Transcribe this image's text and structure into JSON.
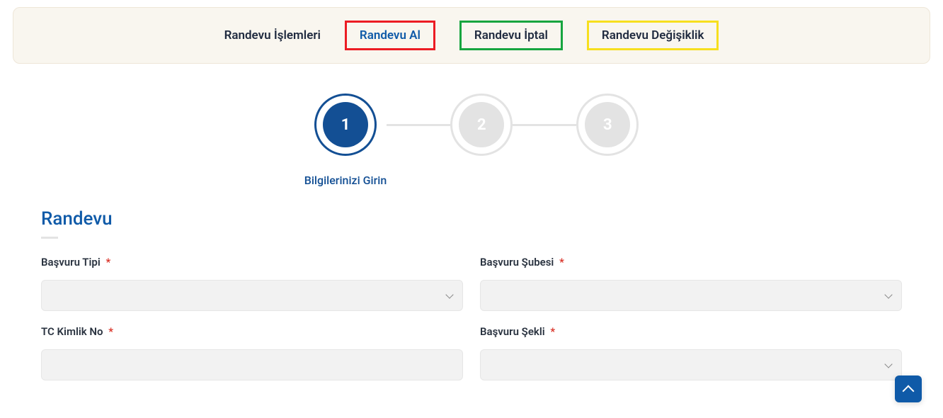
{
  "topbar": {
    "items": [
      {
        "label": "Randevu İşlemleri",
        "active": false,
        "highlight": null
      },
      {
        "label": "Randevu Al",
        "active": true,
        "highlight": "red"
      },
      {
        "label": "Randevu İptal",
        "active": false,
        "highlight": "green"
      },
      {
        "label": "Randevu Değişiklik",
        "active": false,
        "highlight": "yellow"
      }
    ]
  },
  "stepper": {
    "steps": [
      {
        "number": "1",
        "label": "Bilgilerinizi Girin",
        "active": true
      },
      {
        "number": "2",
        "label": "",
        "active": false
      },
      {
        "number": "3",
        "label": "",
        "active": false
      }
    ]
  },
  "section": {
    "title": "Randevu"
  },
  "form": {
    "basvuru_tipi_label": "Başvuru Tipi",
    "basvuru_subesi_label": "Başvuru Şubesi",
    "tc_kimlik_no_label": "TC Kimlik No",
    "basvuru_sekli_label": "Başvuru Şekli",
    "required_marker": "*"
  }
}
